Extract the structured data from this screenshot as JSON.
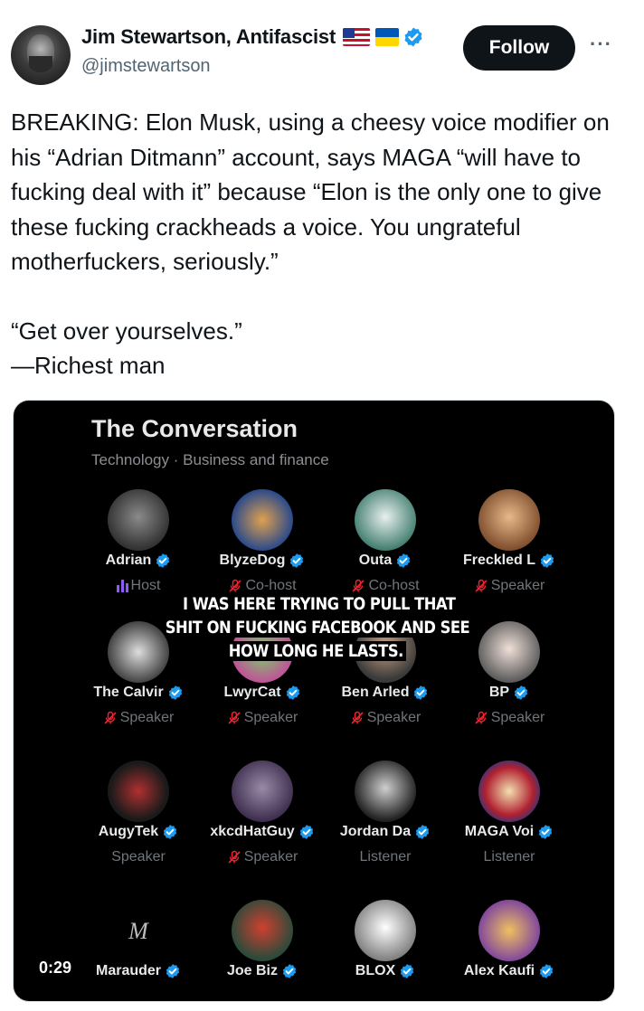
{
  "author": {
    "name": "Jim Stewartson, Antifascist",
    "handle": "@jimstewartson",
    "flags": [
      "us-flag",
      "ukraine-flag"
    ],
    "verified": true
  },
  "actions": {
    "follow_label": "Follow",
    "more_label": "···"
  },
  "tweet": {
    "paragraph1": "BREAKING: Elon Musk, using a cheesy voice modifier on his “Adrian Ditmann” account, says MAGA “will have to fucking deal with it” because “Elon is the only one to give these fucking crackheads a voice. You ungrateful motherfuckers, seriously.”",
    "paragraph2": "“Get over yourselves.”",
    "paragraph3": "—Richest man"
  },
  "media": {
    "title": "The Conversation",
    "subtitle": "Technology · Business and finance",
    "caption": "I WAS HERE TRYING TO PULL THAT SHIT ON FUCKING FACEBOOK AND SEE HOW LONG HE LASTS.",
    "timer": "0:29",
    "accent_color": "#1d9bf0",
    "participants": [
      {
        "name": "Adrian",
        "role": "Host"
      },
      {
        "name": "BlyzeDog",
        "role": "Co-host"
      },
      {
        "name": "Outa",
        "role": "Co-host"
      },
      {
        "name": "Freckled L",
        "role": "Speaker"
      },
      {
        "name": "The Calvir",
        "role": "Speaker"
      },
      {
        "name": "LwyrCat",
        "role": "Speaker"
      },
      {
        "name": "Ben Arled",
        "role": "Speaker"
      },
      {
        "name": "BP",
        "role": "Speaker"
      },
      {
        "name": "AugyTek",
        "role": "Speaker"
      },
      {
        "name": "xkcdHatGuy",
        "role": "Speaker"
      },
      {
        "name": "Jordan Da",
        "role": "Listener"
      },
      {
        "name": "MAGA Voi",
        "role": "Listener"
      },
      {
        "name": "Marauder",
        "role": ""
      },
      {
        "name": "Joe Biz",
        "role": ""
      },
      {
        "name": "BLOX",
        "role": ""
      },
      {
        "name": "Alex Kaufi",
        "role": ""
      }
    ]
  }
}
